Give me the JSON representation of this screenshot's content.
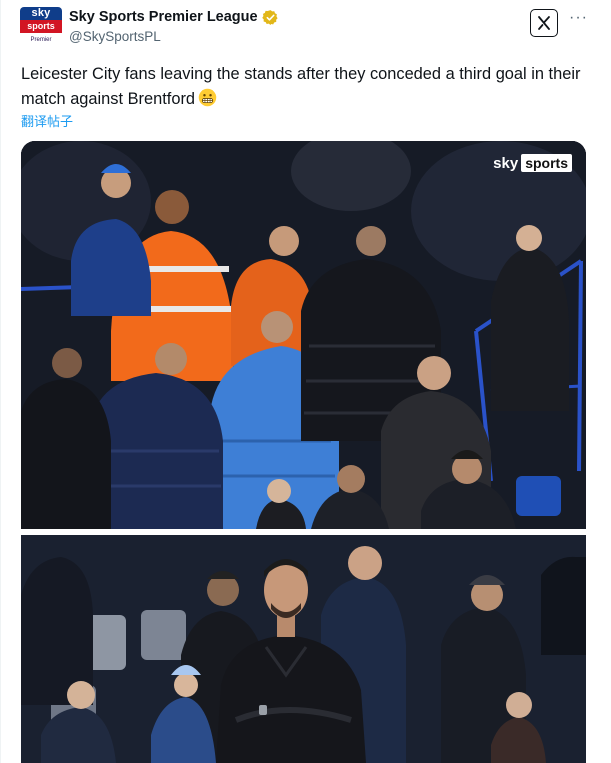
{
  "account": {
    "display_name": "Sky Sports Premier League",
    "handle": "@SkySportsPL",
    "avatar": {
      "line1": "sky",
      "line2": "sports",
      "line3": "Premier League"
    }
  },
  "tweet": {
    "text": "Leicester City fans leaving the stands after they conceded a third goal in their match against Brentford",
    "emoji": "grimacing-face-emoji",
    "translate_label": "翻译帖子"
  },
  "actions": {
    "grok_label": "/",
    "more_label": "···"
  },
  "media": {
    "watermark_sky": "sky",
    "watermark_sports": "sports"
  },
  "colors": {
    "verified_gold": "#e2b719",
    "link_blue": "#1d9bf0",
    "sky_navy": "#0f3d8a",
    "sky_red": "#d21523",
    "steward_orange": "#f26a1b"
  }
}
